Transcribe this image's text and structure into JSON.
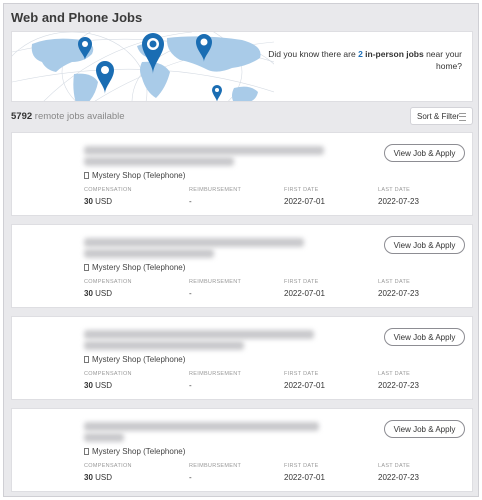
{
  "page": {
    "title": "Web and Phone Jobs"
  },
  "banner": {
    "text_prefix": "Did you know there are ",
    "count": "2",
    "highlight": " in-person jobs",
    "text_suffix": " near your home?",
    "map_pins": [
      "location-pin-icon",
      "location-pin-icon",
      "location-pin-icon",
      "location-pin-icon",
      "location-pin-icon"
    ]
  },
  "results": {
    "count": "5792",
    "count_label": " remote jobs available",
    "sort_filter_label": "Sort & Filter"
  },
  "labels": {
    "compensation": "COMPENSATION",
    "reimbursement": "REIMBURSEMENT",
    "first_date": "FIRST DATE",
    "last_date": "LAST DATE",
    "view_apply": "View Job & Apply"
  },
  "jobs": [
    {
      "category": "Mystery Shop (Telephone)",
      "compensation_amount": "30",
      "compensation_currency": " USD",
      "reimbursement": "-",
      "first_date": "2022-07-01",
      "last_date": "2022-07-23"
    },
    {
      "category": "Mystery Shop (Telephone)",
      "compensation_amount": "30",
      "compensation_currency": " USD",
      "reimbursement": "-",
      "first_date": "2022-07-01",
      "last_date": "2022-07-23"
    },
    {
      "category": "Mystery Shop (Telephone)",
      "compensation_amount": "30",
      "compensation_currency": " USD",
      "reimbursement": "-",
      "first_date": "2022-07-01",
      "last_date": "2022-07-23"
    },
    {
      "category": "Mystery Shop (Telephone)",
      "compensation_amount": "30",
      "compensation_currency": " USD",
      "reimbursement": "-",
      "first_date": "2022-07-01",
      "last_date": "2022-07-23"
    }
  ],
  "colors": {
    "accent": "#1d6fb8",
    "pin": "#1a6db3",
    "map": "#a9cbe8"
  }
}
